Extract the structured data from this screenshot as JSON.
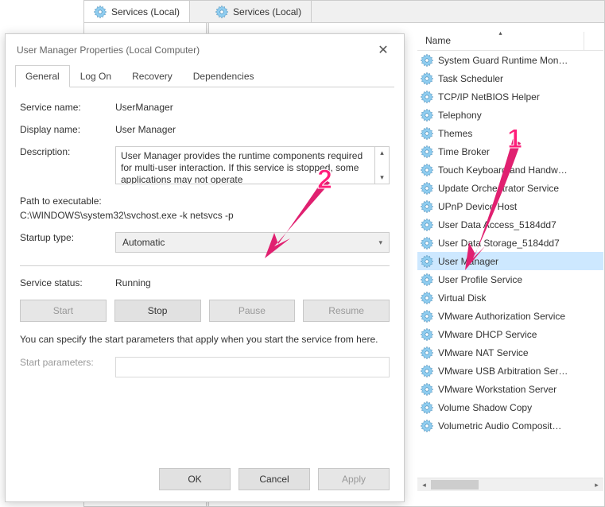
{
  "bg": {
    "tab_left": "Services (Local)",
    "tab_right": "Services (Local)"
  },
  "dialog": {
    "title": "User Manager Properties (Local Computer)",
    "tabs": {
      "general": "General",
      "logon": "Log On",
      "recovery": "Recovery",
      "deps": "Dependencies"
    },
    "labels": {
      "service_name": "Service name:",
      "display_name": "Display name:",
      "description": "Description:",
      "path": "Path to executable:",
      "startup": "Startup type:",
      "status": "Service status:",
      "hint": "You can specify the start parameters that apply when you start the service from here.",
      "start_params": "Start parameters:"
    },
    "values": {
      "service_name": "UserManager",
      "display_name": "User Manager",
      "description": "User Manager provides the runtime components required for multi-user interaction.  If this service is stopped, some applications may not operate",
      "path": "C:\\WINDOWS\\system32\\svchost.exe -k netsvcs -p",
      "startup": "Automatic",
      "status": "Running"
    },
    "buttons": {
      "start": "Start",
      "stop": "Stop",
      "pause": "Pause",
      "resume": "Resume",
      "ok": "OK",
      "cancel": "Cancel",
      "apply": "Apply"
    }
  },
  "svc_header": {
    "name": "Name"
  },
  "services": [
    "System Guard Runtime Mon…",
    "Task Scheduler",
    "TCP/IP NetBIOS Helper",
    "Telephony",
    "Themes",
    "Time Broker",
    "Touch Keyboard and Handw…",
    "Update Orchestrator Service",
    "UPnP Device Host",
    "User Data Access_5184dd7",
    "User Data Storage_5184dd7",
    "User Manager",
    "User Profile Service",
    "Virtual Disk",
    "VMware Authorization Service",
    "VMware DHCP Service",
    "VMware NAT Service",
    "VMware USB Arbitration Ser…",
    "VMware Workstation Server",
    "Volume Shadow Copy",
    "Volumetric Audio Composit…"
  ],
  "selected_service_index": 11,
  "annotations": {
    "a1": "1",
    "a2": "2"
  }
}
